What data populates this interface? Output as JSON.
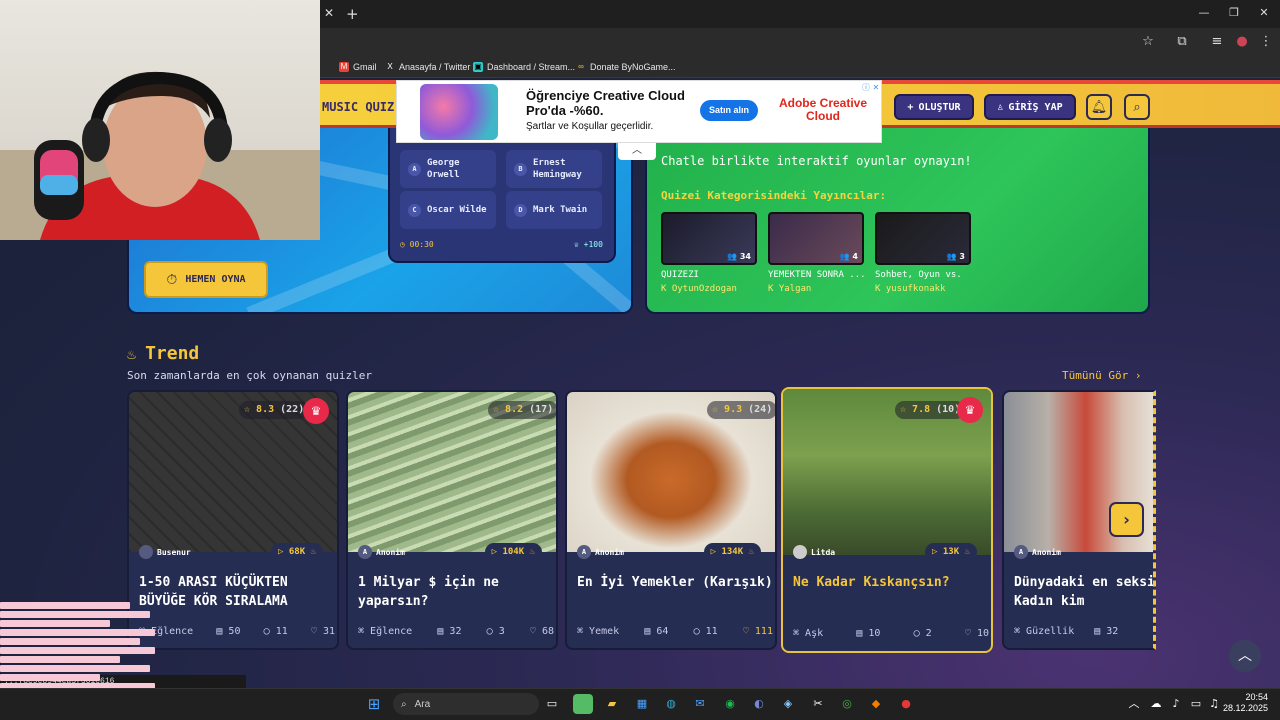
{
  "browser": {
    "bookmarks": [
      {
        "label": "Gmail"
      },
      {
        "label": "Anasayfa / Twitter"
      },
      {
        "label": "Dashboard / Stream..."
      },
      {
        "label": "Donate ByNoGame..."
      }
    ],
    "status_url": "...78c9e8944ea3f361c616"
  },
  "site_header": {
    "logo_text": "MUSIC QUIZ",
    "create_label": "OLUŞTUR",
    "login_label": "GİRİŞ YAP"
  },
  "ad": {
    "title": "Öğrenciye Creative Cloud Pro'da -%60.",
    "terms": "Şartlar ve Koşullar geçerlidir.",
    "button": "Satın alın",
    "brand": "Adobe Creative Cloud"
  },
  "hero": {
    "options": [
      {
        "letter": "A",
        "text": "George Orwell"
      },
      {
        "letter": "B",
        "text": "Ernest Hemingway"
      },
      {
        "letter": "C",
        "text": "Oscar Wilde"
      },
      {
        "letter": "D",
        "text": "Mark Twain"
      }
    ],
    "timer": "00:30",
    "points": "+100",
    "play_label": "HEMEN OYNA",
    "subtitle": "Chatle birlikte interaktif oyunlar oynayın!",
    "streamers_title": "Quizei Kategorisindeki Yayıncılar:",
    "streamers": [
      {
        "title": "QÜİZEZİ",
        "name": "OytunOzdogan",
        "viewers": "34"
      },
      {
        "title": "YEMEKTEN SONRA ...",
        "name": "Yalgan",
        "viewers": "4"
      },
      {
        "title": "Sohbet, Oyun vs.",
        "name": "yusufkonakk",
        "viewers": "3"
      }
    ]
  },
  "trend": {
    "title": "Trend",
    "subtitle": "Son zamanlarda en çok oynanan quizler",
    "see_all": "Tümünü Gör"
  },
  "quizzes": [
    {
      "rating": "8.3",
      "votes": "(22)",
      "author": "Busenur",
      "plays": "68K",
      "title": "1-50 ARASI KÜÇÜKTEN BÜYÜĞE KÖR SIRALAMA",
      "category": "Eğlence",
      "questions": "50",
      "comments": "11",
      "likes": "31"
    },
    {
      "rating": "8.2",
      "votes": "(17)",
      "author": "Anonim",
      "plays": "104K",
      "title": "1 Milyar $ için ne yaparsın?",
      "category": "Eğlence",
      "questions": "32",
      "comments": "3",
      "likes": "68"
    },
    {
      "rating": "9.3",
      "votes": "(24)",
      "author": "Anonim",
      "plays": "134K",
      "title": "En İyi Yemekler (Karışık)",
      "category": "Yemek",
      "questions": "64",
      "comments": "11",
      "likes": "111"
    },
    {
      "rating": "7.8",
      "votes": "(10)",
      "author": "Litda",
      "plays": "13K",
      "title": "Ne Kadar Kıskançsın?",
      "category": "Aşk",
      "questions": "10",
      "comments": "2",
      "likes": "10"
    },
    {
      "rating": "",
      "votes": "",
      "author": "Anonim",
      "plays": "",
      "title": "Dünyadaki en seksi Kadın kim",
      "category": "Güzellik",
      "questions": "32",
      "comments": "",
      "likes": ""
    }
  ],
  "taskbar": {
    "search_placeholder": "Ara",
    "time": "20:54",
    "date": "28.12.2025"
  },
  "colors": {
    "accent_yellow": "#f6c63a",
    "hero_blue": "#1aa3e8",
    "hero_green": "#2ec55a",
    "crown_red": "#e8294a"
  }
}
